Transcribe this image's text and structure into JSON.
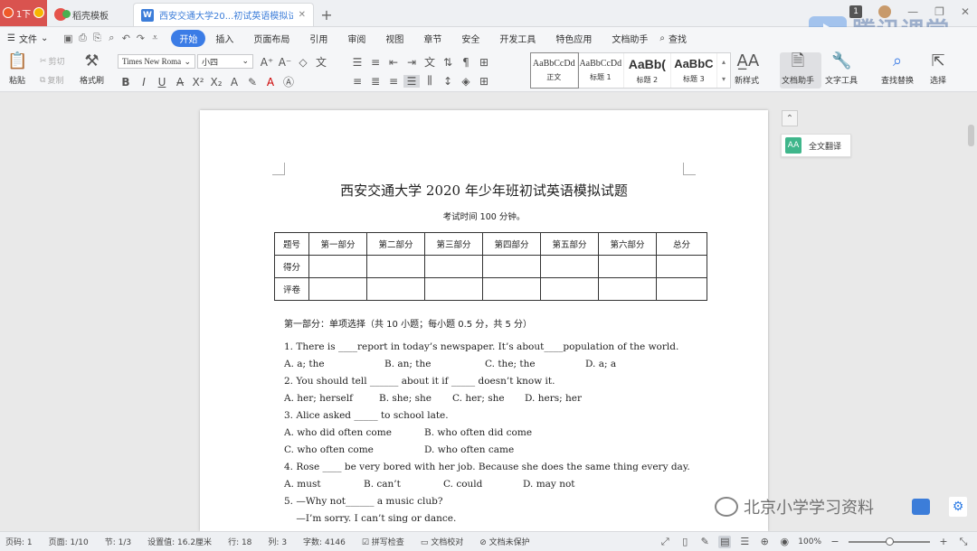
{
  "titlebar": {
    "home_label": "1下",
    "template_tab": "稻壳模板",
    "doc_tab": "西安交通大学20...初试英语模拟试题",
    "doc_icon": "W",
    "new_tab": "+",
    "badge": "1",
    "watermark": "腾讯课堂"
  },
  "menu": {
    "file": "文件",
    "items": [
      "开始",
      "插入",
      "页面布局",
      "引用",
      "审阅",
      "视图",
      "章节",
      "安全",
      "开发工具",
      "特色应用",
      "文档助手"
    ],
    "active": "开始",
    "search": "查找"
  },
  "ribbon": {
    "paste": "粘贴",
    "cut": "剪切",
    "copy": "复制",
    "format_painter": "格式刷",
    "font_name": "Times New Roma",
    "font_size": "小四",
    "styles": [
      {
        "sample": "AaBbCcDd",
        "name": "正文"
      },
      {
        "sample": "AaBbCcDd",
        "name": "标题 1"
      },
      {
        "sample": "AaBb(",
        "name": "标题 2"
      },
      {
        "sample": "AaBbC",
        "name": "标题 3"
      }
    ],
    "new_style": "新样式",
    "doc_assistant": "文档助手",
    "text_tools": "文字工具",
    "find_replace": "查找替换",
    "select": "选择"
  },
  "side": {
    "translate": "全文翻译",
    "translate_icon": "AA"
  },
  "document": {
    "title": "西安交通大学 2020  年少年班初试英语模拟试题",
    "subtitle": "考试时间 100 分钟。",
    "table": {
      "header": [
        "题号",
        "第一部分",
        "第二部分",
        "第三部分",
        "第四部分",
        "第五部分",
        "第六部分",
        "总分"
      ],
      "rows": [
        "得分",
        "评卷"
      ]
    },
    "section1": "第一部分：单项选择（共 10 小题；每小题 0.5 分，共 5 分）",
    "questions": [
      {
        "q": "1. There is ____report in today’s newspaper. It’s about____population of the world.",
        "opts": [
          "A. a; the",
          "B. an; the",
          "C. the; the",
          "D. a; a"
        ]
      },
      {
        "q": "2. You should tell ______ about it if _____ doesn’t know it.",
        "opts": [
          "A. her; herself",
          "B. she; she",
          "C. her; she",
          "D. hers; her"
        ]
      },
      {
        "q": "3. Alice asked _____ to school late.",
        "opts": [
          "A. who did often come",
          "B. who often did come"
        ]
      },
      {
        "q": "",
        "opts": [
          "C. who often come",
          "D. who often came"
        ]
      },
      {
        "q": "4. Rose ____ be very bored with her job. Because she does the same thing every day.",
        "opts": [
          "A. must",
          "B. can’t",
          "C. could",
          "D. may not"
        ]
      },
      {
        "q": "5. —Why not______ a music club?",
        "opts": []
      },
      {
        "q": "    —I’m sorry. I can’t sing or dance.",
        "opts": []
      }
    ]
  },
  "watermark2": "北京小学学习资料",
  "status": {
    "page_no": "页码: 1",
    "pages": "页面: 1/10",
    "section": "节: 1/3",
    "setting": "设置值: 16.2厘米",
    "row": "行: 18",
    "col": "列: 3",
    "words": "字数: 4146",
    "spell": "拼写检查",
    "proof": "文档校对",
    "protect": "文档未保护",
    "zoom": "100%",
    "zoom_level": 0.5
  },
  "colors": {
    "accent": "#3b7ce6",
    "home_tab": "#d9534f",
    "translate": "#3fb68b"
  }
}
